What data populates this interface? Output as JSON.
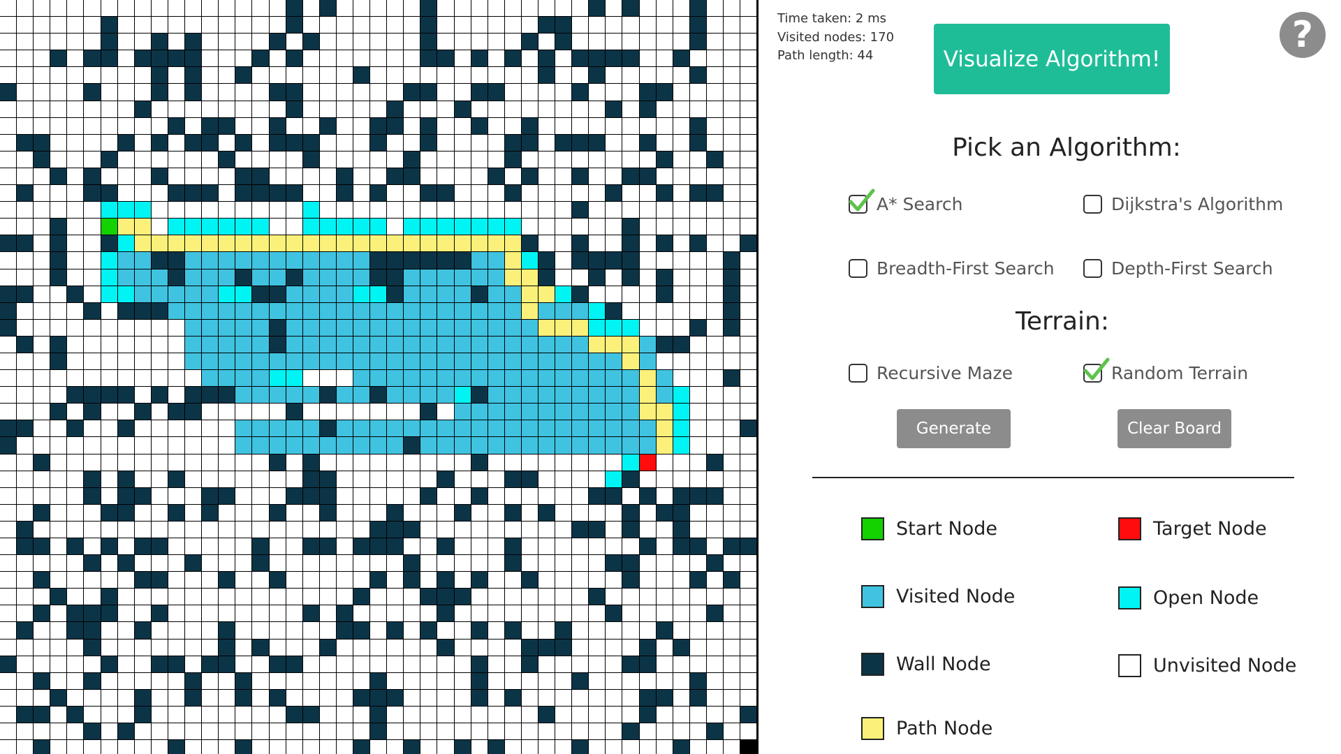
{
  "grid": {
    "cols": 45,
    "rows": 45,
    "legend_codes": {
      ".": "unvisited",
      "#": "wall",
      "v": "visited",
      "o": "open",
      "p": "path",
      "S": "start",
      "T": "target"
    },
    "cells": [
      ".................#.#.....#.........#.#...#...",
      "......#..........#.......#......##.......#...",
      "......#..#.#....#.#......#.....#.#.......#...",
      "...#.##.####...#.#.......##.#.#.#.####..#....",
      ".........#.#..#......#..........#..#.....#...",
      "#....#...#.#....##......##..##....#...##.....",
      "........#........#.....#...#........#.#......",
      "..........#.##..#..#..##.#..#..#.........#...",
      ".##....#.#.##.#.###...#..#....##.###..#..#...",
      "..#...#......#....#.....#.....#........#..#..",
      "...#.#...#....##....#..##....#.#..#..##......",
      ".#...##...###.####..#.#..##...#.....#..#.##..",
      "......ooo.........o...............#..........",
      "...#..Spp.oooooo..ooooo.ooooooo......#.......",
      "##.#..#oppppppppppppppppppppppp#..#..#.#.#..#",
      "...#..ovv##vvvvvvvvvvv######vvpo#.####.....#.",
      "...#..ovvv#vvv#vv#vvvv##vvvvvvpp#..#.#.#...#.",
      "##..#.oovvvvvoo##vvvvoo#vvvv#vvppo#....#...#.",
      "#....#.###vvvvvvvvvvvvvvvvvvvvvpvvvo#......#.",
      "#..........vvvvv#vvvvvvvvvvvvvvvpppooo...#.#.",
      ".#.#.......vvvvv#vvvvvvvvvvvvvvvvvvpppv##....",
      "...#.......vvvvvvvvvvvvvvvvvvvvvvvvvvpv......",
      "............vvvvoo...vvvvvvvvvvvvvvvvvpv...#.",
      "....####.#.###vvvvv#vv#vvvvo#vvvvvvvvvpvo....",
      "...#.#..#.##.....#.......#.vvvvvvvvvvvppo....",
      "##..#..#......vvvvv#vvvvvvvvvvvvvvvvvvvpo...#",
      "#.............vvvvvvvvvv#vvvvvvvvvvvvvvpo....",
      "..#.............#.#.........#........oT...#.",
      "......#.#..#.......##......#...##....o#......",
      "......#.##...##...###.....#..#......##.#.###.",
      "...#...##..#.#...#..#...#...#..#.#....#.##...",
      "..#....................###.........##.#..#...",
      "..##.#.#.##.....#..##.###..#...#.......#.##.#",
      "#.....#.#...#...#........#.....#.....##....#.",
      "...#.....##...#..#.....#.#.#.#..#.....#...#.#",
      "....#..#..............#...###.......#........",
      "...#.###..#........#.#.....#.........#.....#.",
      "..#..##..#....#......##.#.#..#.#..#.....#....",
      "......#.......#.#...#......#....###....#.#...",
      ".#.....#..##.##..##..........#..#.....##.....",
      "...#..#.....#..#.......#.....#.....#......#..",
      "....#....#..#..#.#....###....#.#.......##.#..",
      "..##.#...#........##...#.........#.....#.....",
      "#.....#.#..............#..............#....#.",
      "...#.......#...#......#..#..#.#....#.....#..."
    ]
  },
  "stats": {
    "time": "Time taken: 2 ms",
    "visited": "Visited nodes: 170",
    "path_length": "Path length: 44"
  },
  "visualize_label": "Visualize Algorithm!",
  "help_label": "?",
  "algorithm": {
    "heading": "Pick an Algorithm:",
    "options": [
      {
        "label": "A* Search",
        "checked": true
      },
      {
        "label": "Dijkstra's Algorithm",
        "checked": false
      },
      {
        "label": "Breadth-First Search",
        "checked": false
      },
      {
        "label": "Depth-First Search",
        "checked": false
      }
    ]
  },
  "terrain": {
    "heading": "Terrain:",
    "options": [
      {
        "label": "Recursive Maze",
        "checked": false
      },
      {
        "label": "Random Terrain",
        "checked": true
      }
    ],
    "generate_label": "Generate",
    "clear_label": "Clear Board"
  },
  "legend": [
    {
      "label": "Start Node",
      "color": "#13d200"
    },
    {
      "label": "Target Node",
      "color": "#ff0d0d"
    },
    {
      "label": "Visited Node",
      "color": "#40c3e0"
    },
    {
      "label": "Open Node",
      "color": "#00f4f4"
    },
    {
      "label": "Wall Node",
      "color": "#0c3447"
    },
    {
      "label": "Unvisited Node",
      "color": "#ffffff"
    },
    {
      "label": "Path Node",
      "color": "#fbf17a"
    }
  ],
  "colors": {
    "accent": "#1ebd98",
    "button_gray": "#8c8c8c",
    "check_green": "#5dc24a"
  }
}
